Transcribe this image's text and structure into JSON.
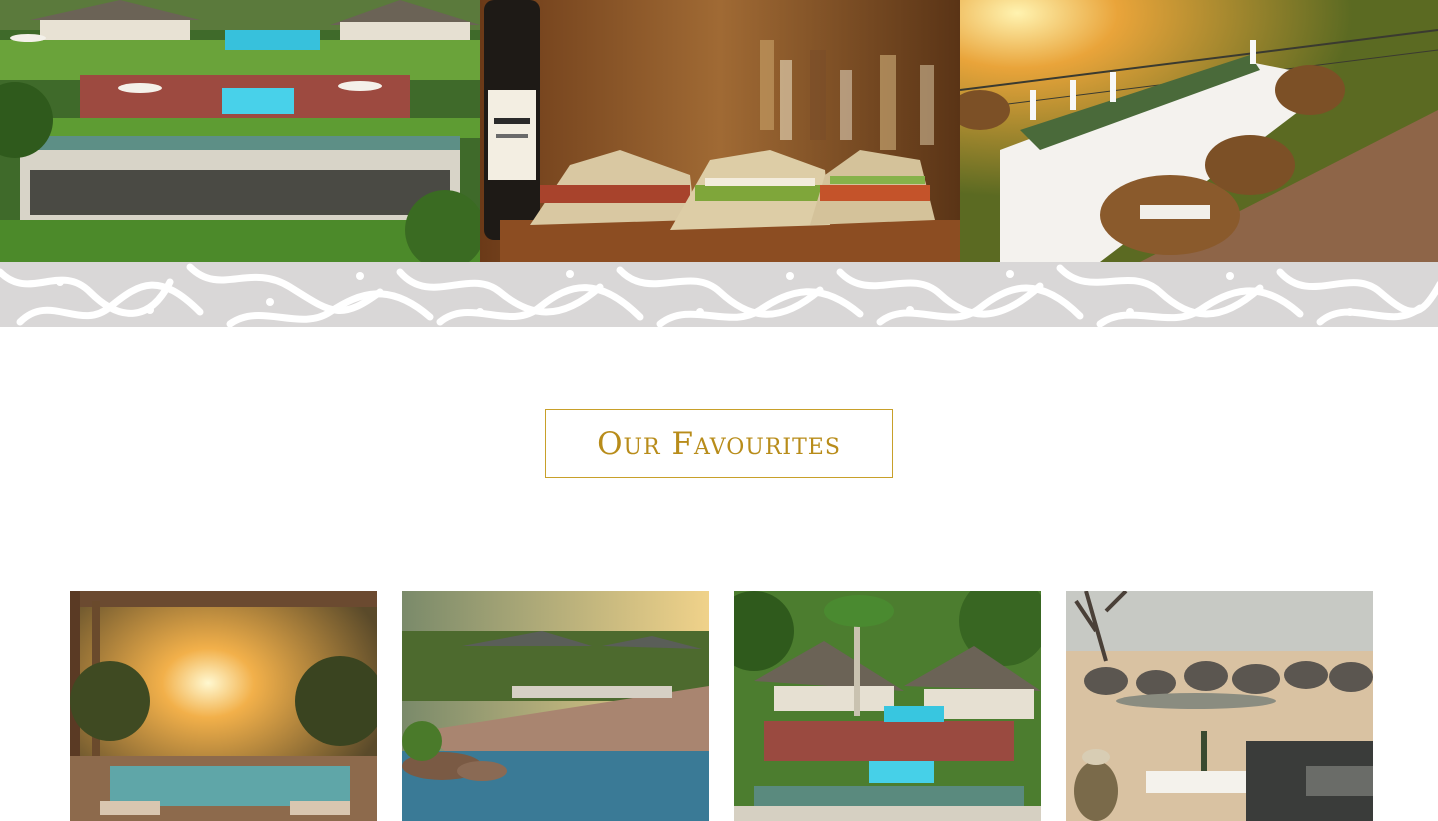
{
  "favourites_section": {
    "title": "Our Favourites"
  },
  "hero_photos": [
    {
      "subject": "aerial-lodge-pools"
    },
    {
      "subject": "beer-and-sandwiches"
    },
    {
      "subject": "deck-dining-sunset"
    }
  ],
  "favourite_cards": [
    {
      "subject": "sunset-deck-plunge-pool"
    },
    {
      "subject": "infinity-pool-lounge"
    },
    {
      "subject": "lodge-gardens-pools"
    },
    {
      "subject": "elephants-waterhole-safari"
    }
  ],
  "colors": {
    "accent_gold": "#b88c1a",
    "border_gold": "#c8a02a",
    "pattern_band": "#d9d7d7",
    "pattern_shape": "#ffffff"
  }
}
